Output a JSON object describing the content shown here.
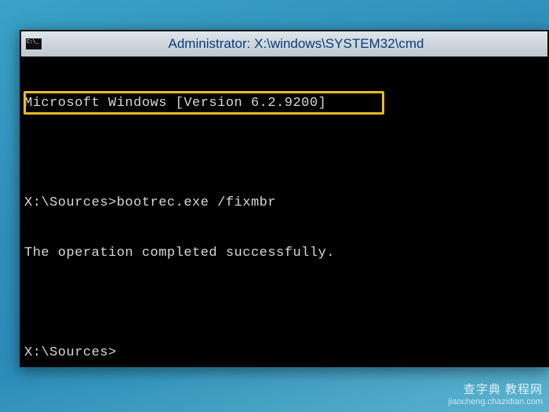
{
  "window": {
    "title": "Administrator: X:\\windows\\SYSTEM32\\cmd",
    "icon_name": "cmd-prompt-icon"
  },
  "terminal": {
    "lines": [
      "Microsoft Windows [Version 6.2.9200]",
      "",
      "X:\\Sources>bootrec.exe /fixmbr",
      "The operation completed successfully.",
      "",
      "X:\\Sources>"
    ],
    "highlighted_line_index": 2
  },
  "watermark": {
    "main": "查字典 教程网",
    "sub": "jiaocheng.chazidian.com"
  }
}
